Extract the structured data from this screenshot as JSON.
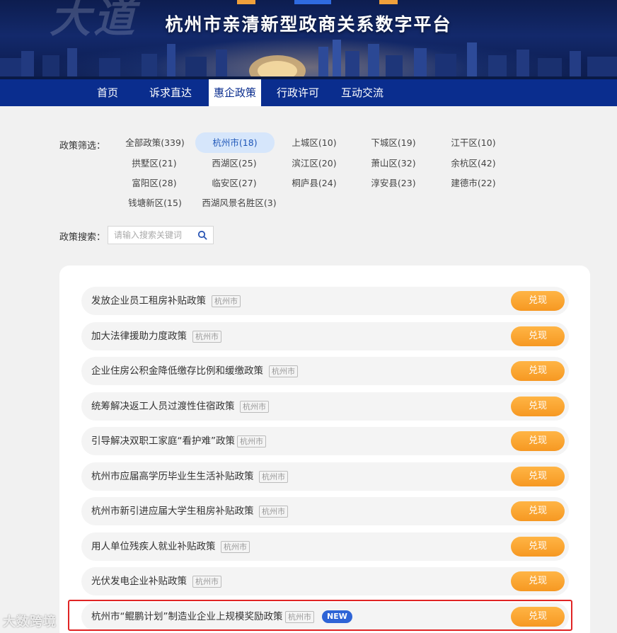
{
  "header": {
    "title": "杭州市亲清新型政商关系数字平台"
  },
  "nav": [
    {
      "label": "首页",
      "active": false
    },
    {
      "label": "诉求直达",
      "active": false
    },
    {
      "label": "惠企政策",
      "active": true
    },
    {
      "label": "行政许可",
      "active": false
    },
    {
      "label": "互动交流",
      "active": false
    }
  ],
  "filter": {
    "label": "政策筛选：",
    "chips": [
      {
        "label": "全部政策(339)",
        "active": false
      },
      {
        "label": "杭州市(18)",
        "active": true
      },
      {
        "label": "上城区(10)",
        "active": false
      },
      {
        "label": "下城区(19)",
        "active": false
      },
      {
        "label": "江干区(10)",
        "active": false
      },
      {
        "label": "拱墅区(21)",
        "active": false
      },
      {
        "label": "西湖区(25)",
        "active": false
      },
      {
        "label": "滨江区(20)",
        "active": false
      },
      {
        "label": "萧山区(32)",
        "active": false
      },
      {
        "label": "余杭区(42)",
        "active": false
      },
      {
        "label": "富阳区(28)",
        "active": false
      },
      {
        "label": "临安区(27)",
        "active": false
      },
      {
        "label": "桐庐县(24)",
        "active": false
      },
      {
        "label": "淳安县(23)",
        "active": false
      },
      {
        "label": "建德市(22)",
        "active": false
      },
      {
        "label": "钱塘新区(15)",
        "active": false
      },
      {
        "label": "西湖风景名胜区(3)",
        "active": false
      }
    ]
  },
  "search": {
    "label": "政策搜索：",
    "placeholder": "请输入搜索关键词",
    "value": ""
  },
  "policies": [
    {
      "name": "发放企业员工租房补贴政策",
      "tag": "杭州市",
      "button": "兑现"
    },
    {
      "name": "加大法律援助力度政策",
      "tag": "杭州市",
      "button": "兑现"
    },
    {
      "name": "企业住房公积金降低缴存比例和缓缴政策",
      "tag": "杭州市",
      "button": "兑现"
    },
    {
      "name": "统筹解决返工人员过渡性住宿政策",
      "tag": "杭州市",
      "button": "兑现"
    },
    {
      "name": "引导解决双职工家庭“看护难”政策",
      "tag": "杭州市",
      "button": "兑现"
    },
    {
      "name": "杭州市应届高学历毕业生生活补贴政策",
      "tag": "杭州市",
      "button": "兑现"
    },
    {
      "name": "杭州市新引进应届大学生租房补贴政策",
      "tag": "杭州市",
      "button": "兑现"
    },
    {
      "name": "用人单位残疾人就业补贴政策",
      "tag": "杭州市",
      "button": "兑现"
    },
    {
      "name": "光伏发电企业补贴政策",
      "tag": "杭州市",
      "button": "兑现"
    },
    {
      "name": "杭州市“鲲鹏计划”制造业企业上规模奖励政策",
      "tag": "杭州市",
      "badge": "NEW",
      "button": "兑现"
    }
  ],
  "watermark": "大数跨境",
  "colors": {
    "nav": "#0a2d8e",
    "button": "#f69822",
    "active_chip": "#d6e6fb",
    "new_badge": "#2e64d6",
    "highlight": "#e02424"
  }
}
